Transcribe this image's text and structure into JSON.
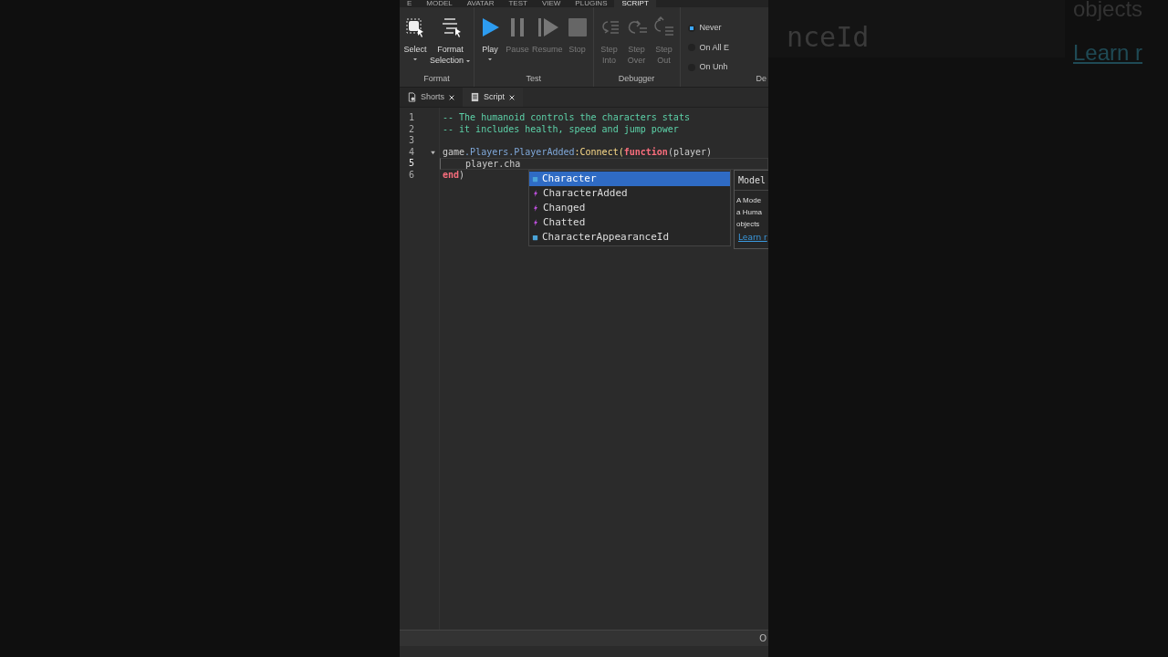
{
  "ribbon_tabs": [
    {
      "label": "E",
      "selected": false
    },
    {
      "label": "MODEL",
      "selected": false
    },
    {
      "label": "AVATAR",
      "selected": false
    },
    {
      "label": "TEST",
      "selected": false
    },
    {
      "label": "VIEW",
      "selected": false
    },
    {
      "label": "PLUGINS",
      "selected": false
    },
    {
      "label": "SCRIPT",
      "selected": true
    }
  ],
  "ribbon_groups": [
    {
      "label": "Format",
      "tools": [
        {
          "kind": "select",
          "label": "Select",
          "dropdown": true,
          "disabled": false
        },
        {
          "kind": "format",
          "label": "Format Selection",
          "dropdown": true,
          "disabled": false
        }
      ]
    },
    {
      "label": "Test",
      "tools": [
        {
          "kind": "play",
          "label": "Play",
          "dropdown": true,
          "disabled": false
        },
        {
          "kind": "pause",
          "label": "Pause",
          "dropdown": false,
          "disabled": true
        },
        {
          "kind": "resume",
          "label": "Resume",
          "dropdown": false,
          "disabled": true
        },
        {
          "kind": "stop",
          "label": "Stop",
          "dropdown": false,
          "disabled": true
        }
      ]
    },
    {
      "label": "Debugger",
      "tools": [
        {
          "kind": "step-into",
          "label": "Step Into",
          "dropdown": false,
          "disabled": true
        },
        {
          "kind": "step-over",
          "label": "Step Over",
          "dropdown": false,
          "disabled": true
        },
        {
          "kind": "step-out",
          "label": "Step Out",
          "dropdown": false,
          "disabled": true
        }
      ]
    }
  ],
  "error_options": {
    "label": "De",
    "options": [
      {
        "label": "Never",
        "selected": true
      },
      {
        "label": "On All E",
        "selected": false
      },
      {
        "label": "On Unh",
        "selected": false
      }
    ]
  },
  "doc_tabs": [
    {
      "kind": "place",
      "label": "Shorts",
      "selected": false
    },
    {
      "kind": "script",
      "label": "Script",
      "selected": true
    }
  ],
  "code_lines": [
    {
      "number": "1",
      "current": false,
      "fold": false,
      "tokens": [
        {
          "text": "-- The humanoid controls the characters stats",
          "kind": "comment"
        }
      ]
    },
    {
      "number": "2",
      "current": false,
      "fold": false,
      "tokens": [
        {
          "text": "-- it includes health, speed and jump power",
          "kind": "comment"
        }
      ]
    },
    {
      "number": "3",
      "current": false,
      "fold": false
    },
    {
      "number": "4",
      "current": false,
      "fold": true,
      "tokens": [
        {
          "text": "game",
          "kind": "plain"
        },
        {
          "text": ".Players.PlayerAdded",
          "kind": "member"
        },
        {
          "text": ":Connect(",
          "kind": "call"
        },
        {
          "text": "function",
          "kind": "keyword"
        },
        {
          "text": "(player)",
          "kind": "plain"
        }
      ]
    },
    {
      "number": "5",
      "current": true,
      "fold": false,
      "tokens": [
        {
          "text": "    player.cha",
          "kind": "plain"
        }
      ]
    },
    {
      "number": "6",
      "current": false,
      "fold": false,
      "tokens": [
        {
          "text": "end",
          "kind": "keyword"
        },
        {
          "text": ")",
          "kind": "plain"
        }
      ]
    }
  ],
  "autocomplete": [
    {
      "label": "Character",
      "kind": "property",
      "selected": true
    },
    {
      "label": "CharacterAdded",
      "kind": "event",
      "selected": false
    },
    {
      "label": "Changed",
      "kind": "event",
      "selected": false
    },
    {
      "label": "Chatted",
      "kind": "event",
      "selected": false
    },
    {
      "label": "CharacterAppearanceId",
      "kind": "property",
      "selected": false
    }
  ],
  "doc_tooltip": {
    "title": "Model",
    "description": [
      "A Mode",
      "a Huma",
      "objects"
    ],
    "link": "Learn r"
  },
  "status_bar": {
    "text": "O"
  },
  "background_fragments": {
    "code": "nceId",
    "description": "objects",
    "link": "Learn r"
  }
}
